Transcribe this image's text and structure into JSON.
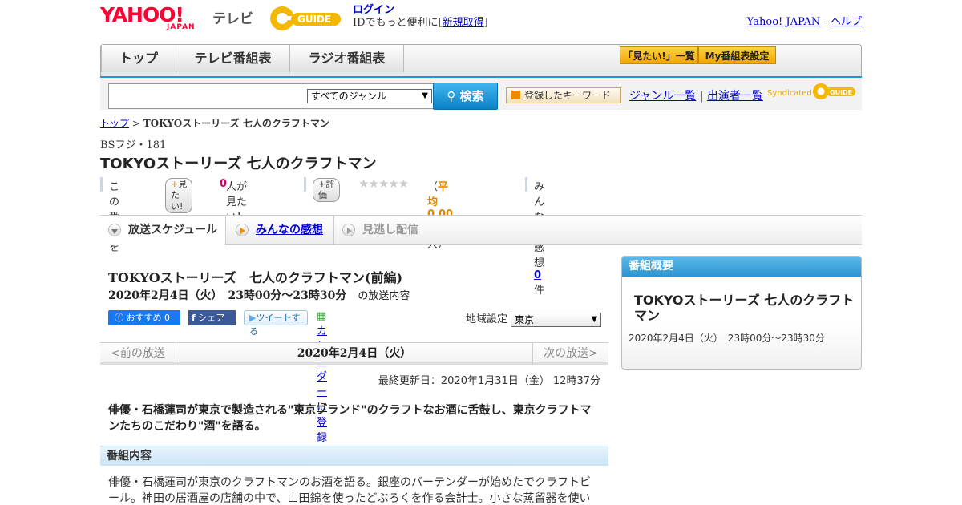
{
  "header": {
    "logo_text": "YAHOO!",
    "logo_sub": "JAPAN",
    "service": "テレビ",
    "gguide_logo": "G-GUIDE",
    "login_label": "ログイン",
    "login_prompt": "IDでもっと便利に[",
    "signup_label": "新規取得",
    "login_suffix": "]",
    "yahoo_link": "Yahoo! JAPAN",
    "dash": "-",
    "help_link": "ヘルプ"
  },
  "nav": {
    "tabs": [
      "トップ",
      "テレビ番組表",
      "ラジオ番組表"
    ],
    "mitai_list": "「見たい!」一覧",
    "my_schedule": "My番組表設定"
  },
  "search": {
    "genre_selected": "すべてのジャンル",
    "button_label": "検索",
    "keyword_button": "登録したキーワード",
    "genre_list": "ジャンル一覧",
    "divider": "|",
    "cast_list": "出演者一覧",
    "syndicated": "Syndicated"
  },
  "breadcrumb": {
    "home": "トップ",
    "sep": ">",
    "current": "TOKYOストーリーズ 七人のクラフトマン"
  },
  "program": {
    "station": "BSフジ・181",
    "title": "TOKYOストーリーズ 七人のクラフトマン",
    "want_prefix": "この番組を",
    "want_button": "見たい!",
    "want_count": "0",
    "want_suffix": "人が見たい！",
    "rate_button": "評価",
    "stars": "★★★★★",
    "avg_open": "（",
    "avg_value": "平均0.00点",
    "avg_rest": "/0人）",
    "impressions_label": "みんなの感想",
    "impressions_count": "0",
    "impressions_unit": "件"
  },
  "tabs": {
    "schedule": "放送スケジュール",
    "impressions": "みんなの感想",
    "missed": "見逃し配信"
  },
  "episode": {
    "title": "TOKYOストーリーズ　七人のクラフトマン(前編)",
    "datetime": "2020年2月4日（火）　23時00分～23時30分",
    "datetime_suffix": "の放送内容",
    "fb_recommend": "おすすめ 0",
    "fb_share": "シェア",
    "tweet": "ツイートする",
    "calendar": "カレンダーに登録",
    "region_label": "地域設定",
    "region_value": "東京",
    "prev": "<前の放送",
    "current_date": "2020年2月4日（火）",
    "next": "次の放送>",
    "updated": "最終更新日：2020年1月31日（金）  12時37分",
    "lead": "俳優・石橋蓮司が東京で製造される\"東京ブランド\"のクラフトなお酒に舌鼓し、東京クラフトマンたちのこだわり\"酒\"を語る。",
    "section_title": "番組内容",
    "body": "俳優・石橋蓮司が東京のクラフトマンのお酒を語る。銀座のバーテンダーが始めたでクラフトビール。神田の居酒屋の店舗の中で、山田錦を使ったどぶろくを作る会計士。小さな蒸留器を使い"
  },
  "sidebar": {
    "header": "番組概要",
    "title": "TOKYOストーリーズ 七人のクラフトマン",
    "datetime": "2020年2月4日（火）　23時00分～23時30分"
  },
  "colors": {
    "yahoo_red": "#ff0033",
    "accent_blue": "#1a9bd7",
    "gguide_yellow": "#f5b800",
    "link": "#0000cc"
  }
}
